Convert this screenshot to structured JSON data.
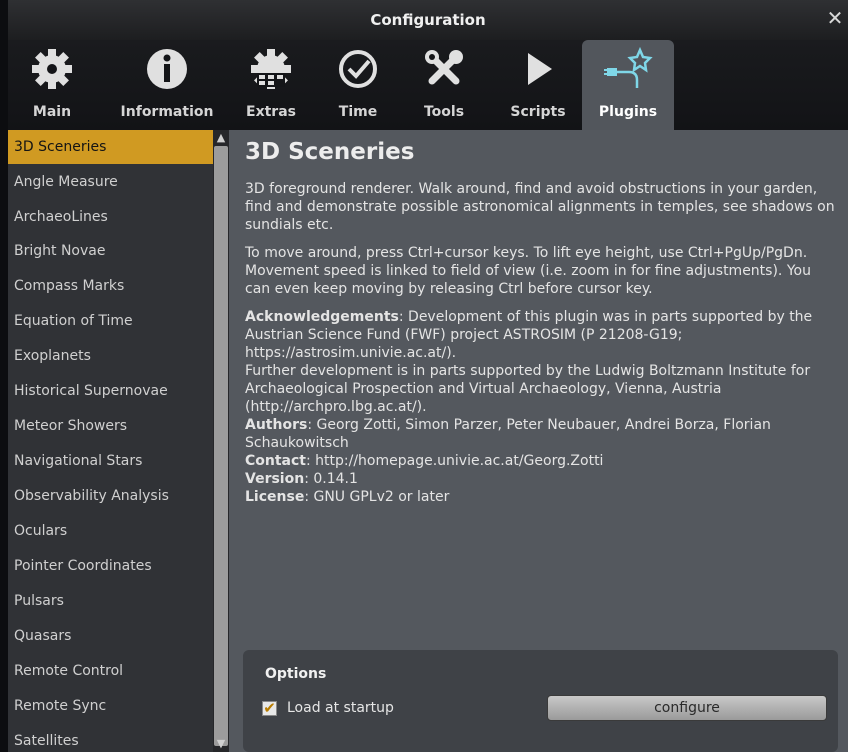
{
  "window": {
    "title": "Configuration",
    "close_symbol": "✕"
  },
  "tabs": [
    {
      "label": "Main",
      "icon": "gear-icon"
    },
    {
      "label": "Information",
      "icon": "info-icon"
    },
    {
      "label": "Extras",
      "icon": "extras-gear-icon"
    },
    {
      "label": "Time",
      "icon": "clock-icon"
    },
    {
      "label": "Tools",
      "icon": "tools-icon"
    },
    {
      "label": "Scripts",
      "icon": "play-icon"
    },
    {
      "label": "Plugins",
      "icon": "plugin-icon",
      "active": true
    }
  ],
  "sidebar": {
    "items": [
      "3D Sceneries",
      "Angle Measure",
      "ArchaeoLines",
      "Bright Novae",
      "Compass Marks",
      "Equation of Time",
      "Exoplanets",
      "Historical Supernovae",
      "Meteor Showers",
      "Navigational Stars",
      "Observability Analysis",
      "Oculars",
      "Pointer Coordinates",
      "Pulsars",
      "Quasars",
      "Remote Control",
      "Remote Sync",
      "Satellites"
    ],
    "selected": "3D Sceneries",
    "scroll_up": "▲",
    "scroll_down": "▼"
  },
  "plugin": {
    "title": "3D Sceneries",
    "desc1": "3D foreground renderer. Walk around, find and avoid obstructions in your garden, find and demonstrate possible astronomical alignments in temples, see shadows on sundials etc.",
    "desc2": "To move around, press Ctrl+cursor keys. To lift eye height, use Ctrl+PgUp/PgDn. Movement speed is linked to field of view (i.e. zoom in for fine adjustments). You can even keep moving by releasing Ctrl before cursor key.",
    "ack_label": "Acknowledgements",
    "ack_text": ": Development of this plugin was in parts supported by the Austrian Science Fund (FWF) project ASTROSIM (P 21208-G19; https://astrosim.univie.ac.at/).",
    "further": "Further development is in parts supported by the Ludwig Boltzmann Institute for Archaeological Prospection and Virtual Archaeology, Vienna, Austria (http://archpro.lbg.ac.at/).",
    "authors_label": "Authors",
    "authors_text": ": Georg Zotti, Simon Parzer, Peter Neubauer, Andrei Borza, Florian Schaukowitsch",
    "contact_label": "Contact",
    "contact_text": ": http://homepage.univie.ac.at/Georg.Zotti",
    "version_label": "Version",
    "version_text": ": 0.14.1",
    "license_label": "License",
    "license_text": ": GNU GPLv2 or later"
  },
  "options": {
    "title": "Options",
    "load_label": "Load at startup",
    "load_checked": true,
    "check_mark": "✔",
    "configure_label": "configure"
  },
  "colors": {
    "accent": "#d09a22",
    "panel": "#54585e",
    "sidebar": "#303236"
  }
}
